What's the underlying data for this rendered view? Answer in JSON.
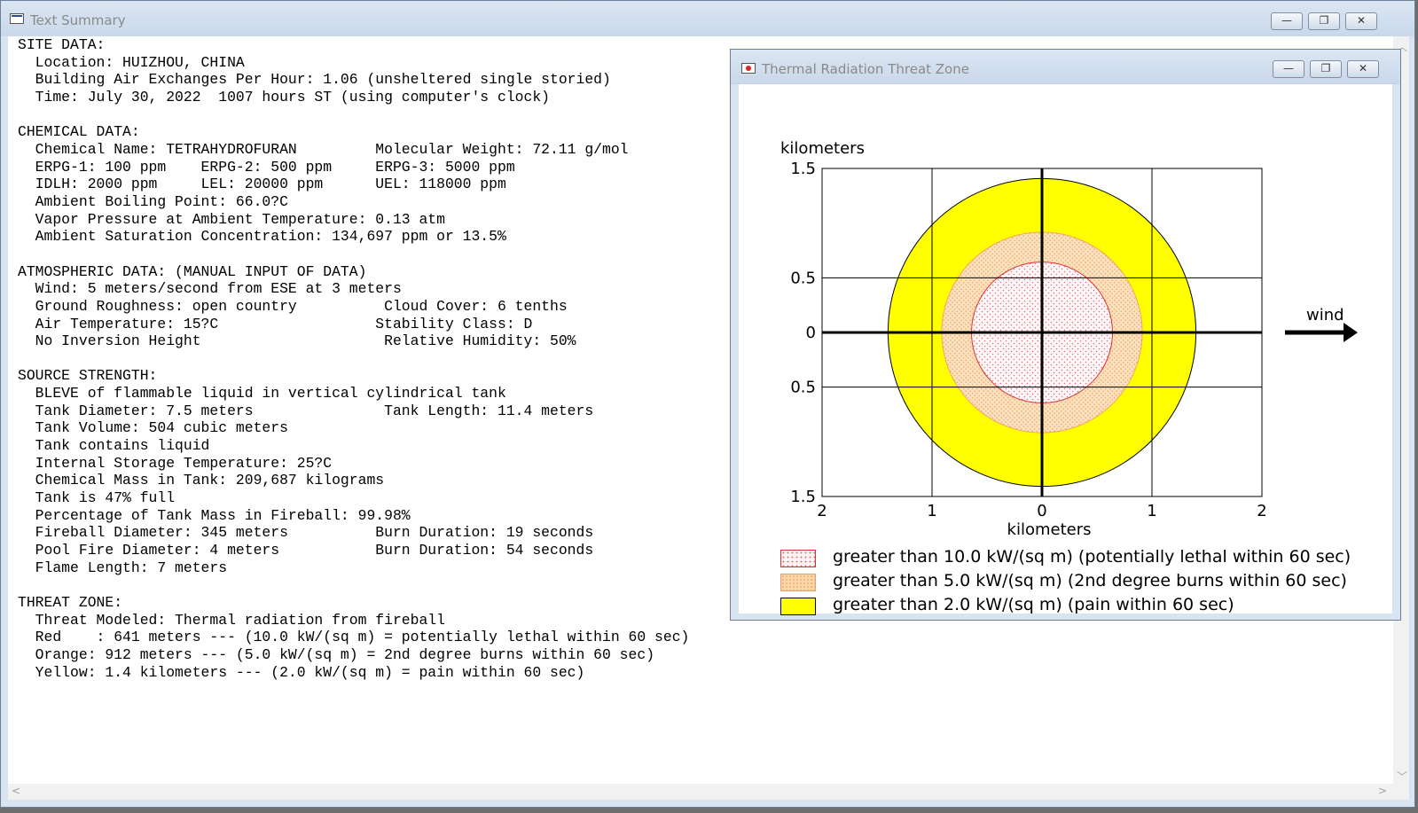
{
  "main_window": {
    "title": "Text Summary",
    "buttons": {
      "minimize": "—",
      "maximize": "❐",
      "close": "✕"
    }
  },
  "summary_lines": [
    "SITE DATA:",
    "  Location: HUIZHOU, CHINA",
    "  Building Air Exchanges Per Hour: 1.06 (unsheltered single storied)",
    "  Time: July 30, 2022  1007 hours ST (using computer's clock)",
    "",
    "CHEMICAL DATA:",
    "  Chemical Name: TETRAHYDROFURAN         Molecular Weight: 72.11 g/mol",
    "  ERPG-1: 100 ppm    ERPG-2: 500 ppm     ERPG-3: 5000 ppm",
    "  IDLH: 2000 ppm     LEL: 20000 ppm      UEL: 118000 ppm",
    "  Ambient Boiling Point: 66.0?C",
    "  Vapor Pressure at Ambient Temperature: 0.13 atm",
    "  Ambient Saturation Concentration: 134,697 ppm or 13.5%",
    "",
    "ATMOSPHERIC DATA: (MANUAL INPUT OF DATA)",
    "  Wind: 5 meters/second from ESE at 3 meters",
    "  Ground Roughness: open country          Cloud Cover: 6 tenths",
    "  Air Temperature: 15?C                  Stability Class: D",
    "  No Inversion Height                     Relative Humidity: 50%",
    "",
    "SOURCE STRENGTH:",
    "  BLEVE of flammable liquid in vertical cylindrical tank",
    "  Tank Diameter: 7.5 meters               Tank Length: 11.4 meters",
    "  Tank Volume: 504 cubic meters",
    "  Tank contains liquid",
    "  Internal Storage Temperature: 25?C",
    "  Chemical Mass in Tank: 209,687 kilograms",
    "  Tank is 47% full",
    "  Percentage of Tank Mass in Fireball: 99.98%",
    "  Fireball Diameter: 345 meters          Burn Duration: 19 seconds",
    "  Pool Fire Diameter: 4 meters           Burn Duration: 54 seconds",
    "  Flame Length: 7 meters",
    "",
    "THREAT ZONE:",
    "  Threat Modeled: Thermal radiation from fireball",
    "  Red    : 641 meters --- (10.0 kW/(sq m) = potentially lethal within 60 sec)",
    "  Orange: 912 meters --- (5.0 kW/(sq m) = 2nd degree burns within 60 sec)",
    "  Yellow: 1.4 kilometers --- (2.0 kW/(sq m) = pain within 60 sec)"
  ],
  "threat_window": {
    "title": "Thermal Radiation Threat Zone",
    "buttons": {
      "minimize": "—",
      "maximize": "❐",
      "close": "✕"
    }
  },
  "chart_data": {
    "type": "threat-zone-circles",
    "ylabel": "kilometers",
    "xlabel": "kilometers",
    "wind_label": "wind",
    "xlim": [
      -2,
      2
    ],
    "ylim": [
      -1.5,
      1.5
    ],
    "x_ticks": [
      {
        "value": -2,
        "label": "2"
      },
      {
        "value": -1,
        "label": "1"
      },
      {
        "value": 0,
        "label": "0"
      },
      {
        "value": 1,
        "label": "1"
      },
      {
        "value": 2,
        "label": "2"
      }
    ],
    "y_ticks": [
      {
        "value": 1.5,
        "label": "1.5"
      },
      {
        "value": 0.5,
        "label": "0.5"
      },
      {
        "value": 0,
        "label": "0"
      },
      {
        "value": -0.5,
        "label": "0.5"
      },
      {
        "value": -1.5,
        "label": "1.5"
      }
    ],
    "zones": [
      {
        "name": "yellow",
        "radius_km": 1.4,
        "fill": "#ffff00",
        "stroke": "#000000",
        "label": "greater than 2.0 kW/(sq m) (pain within 60 sec)"
      },
      {
        "name": "orange",
        "radius_km": 0.912,
        "fill": "#fbd8a8",
        "stroke": "#f4a460",
        "label": "greater than 5.0 kW/(sq m) (2nd degree burns within 60 sec)"
      },
      {
        "name": "red",
        "radius_km": 0.641,
        "fill": "#fde8ec",
        "stroke": "#e0302e",
        "label": "greater than 10.0 kW/(sq m) (potentially lethal within 60 sec)"
      }
    ],
    "legend_order": [
      "red",
      "orange",
      "yellow"
    ]
  }
}
